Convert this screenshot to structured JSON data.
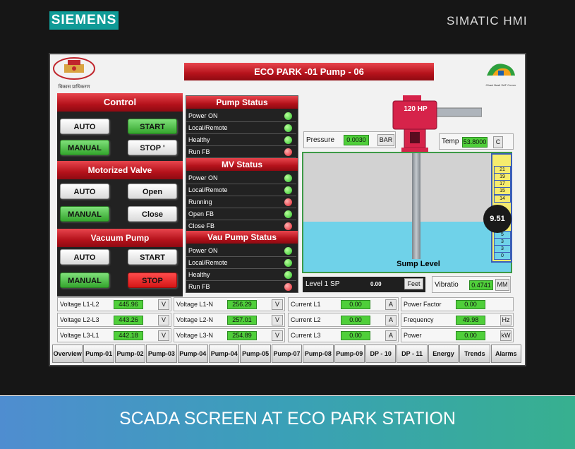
{
  "header": {
    "brand": "SIEMENS",
    "product": "SIMATIC HMI"
  },
  "title": "ECO PARK -01 Pump - 06",
  "logo_left_text": "विकास प्राधिकरण",
  "logo_right_text": "Ghani Basti SAF Corner",
  "control": {
    "title": "Control",
    "auto": "AUTO",
    "start": "START",
    "manual": "MANUAL",
    "stop": "STOP '"
  },
  "mv": {
    "title": "Motorized Valve",
    "auto": "AUTO",
    "open": "Open",
    "manual": "MANUAL",
    "close": "Close"
  },
  "vacuum": {
    "title": "Vacuum Pump",
    "auto": "AUTO",
    "start": "START",
    "manual": "MANUAL",
    "stop": "STOP"
  },
  "pump_status": {
    "title": "Pump Status",
    "items": [
      {
        "label": "Power  ON",
        "color": "#2ec02a"
      },
      {
        "label": "Local/Remote",
        "color": "#2ec02a"
      },
      {
        "label": "Healthy",
        "color": "#2ec02a"
      },
      {
        "label": "Run FB",
        "color": "#e3222c"
      }
    ]
  },
  "mv_status": {
    "title": "MV Status",
    "items": [
      {
        "label": "Power  ON",
        "color": "#2ec02a"
      },
      {
        "label": "Local/Remote",
        "color": "#2ec02a"
      },
      {
        "label": "Running",
        "color": "#e3222c"
      },
      {
        "label": "Open FB",
        "color": "#2ec02a"
      },
      {
        "label": "Close FB",
        "color": "#e3222c"
      }
    ]
  },
  "vac_status": {
    "title": "Vau Pump Status",
    "items": [
      {
        "label": "Power  ON",
        "color": "#2ec02a"
      },
      {
        "label": "Local/Remote",
        "color": "#2ec02a"
      },
      {
        "label": "Healthy",
        "color": "#2ec02a"
      },
      {
        "label": "Run FB",
        "color": "#e3222c"
      }
    ]
  },
  "pump": {
    "hp": "120 HP"
  },
  "pressure": {
    "label": "Pressure",
    "value": "0.0030",
    "unit": "BAR"
  },
  "temp": {
    "label": "Temp",
    "value": "53.8000",
    "unit": "C"
  },
  "sump": {
    "label": "Sump Level",
    "level_value": "9.51",
    "scale": [
      "21",
      "19",
      "17",
      "15",
      "14",
      "5",
      "3",
      "3",
      "0"
    ]
  },
  "level_sp": {
    "label": "Level 1 SP",
    "value": "0.00",
    "unit": "Feet"
  },
  "vibration": {
    "label": "Vibratio",
    "value": "0.4741",
    "unit": "MM"
  },
  "readings": [
    [
      {
        "label": "Voltage L1-L2",
        "value": "445.96",
        "unit": "V"
      },
      {
        "label": "Voltage L2-L3",
        "value": "443.26",
        "unit": "V"
      },
      {
        "label": "Voltage L3-L1",
        "value": "442.18",
        "unit": "V"
      }
    ],
    [
      {
        "label": "Voltage L1-N",
        "value": "256.29",
        "unit": "V"
      },
      {
        "label": "Voltage L2-N",
        "value": "257.01",
        "unit": "V"
      },
      {
        "label": "Voltage L3-N",
        "value": "254.89",
        "unit": "V"
      }
    ],
    [
      {
        "label": "Current L1",
        "value": "0.00",
        "unit": "A"
      },
      {
        "label": "Current L2",
        "value": "0.00",
        "unit": "A"
      },
      {
        "label": "Current L3",
        "value": "0.00",
        "unit": "A"
      }
    ],
    [
      {
        "label": "Power Factor",
        "value": "0.00",
        "unit": ""
      },
      {
        "label": "Frequency",
        "value": "49.98",
        "unit": "Hz"
      },
      {
        "label": "Power",
        "value": "0.00",
        "unit": "kW"
      }
    ]
  ],
  "nav": [
    "Overview",
    "Pump-01",
    "Pump-02",
    "Pump-03",
    "Pump-04",
    "Pump-04",
    "Pump-05",
    "Pump-07",
    "Pump-08",
    "Pump-09",
    "DP - 10",
    "DP - 11",
    "Energy",
    "Trends",
    "Alarms"
  ],
  "caption": "SCADA SCREEN AT ECO PARK STATION"
}
